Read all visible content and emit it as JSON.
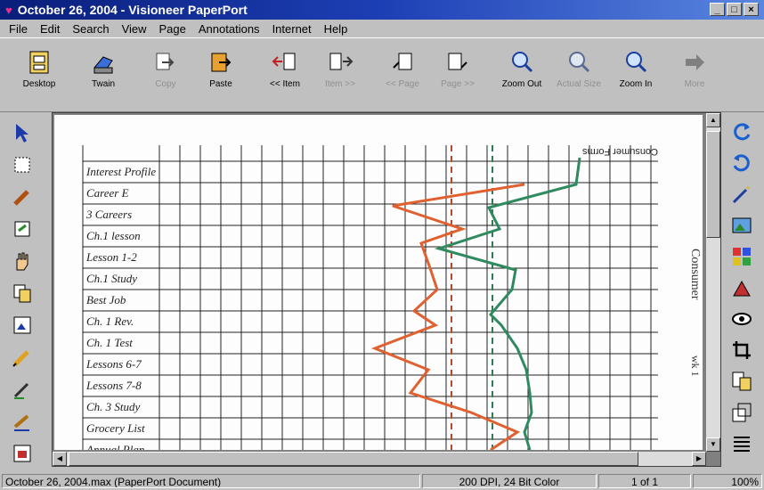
{
  "window": {
    "title": "October 26, 2004 - Visioneer PaperPort",
    "minimize": "_",
    "maximize": "□",
    "close": "×"
  },
  "menu": [
    "File",
    "Edit",
    "Search",
    "View",
    "Page",
    "Annotations",
    "Internet",
    "Help"
  ],
  "toolbar": {
    "desktop": "Desktop",
    "twain": "Twain",
    "copy": "Copy",
    "paste": "Paste",
    "item_back": "<< Item",
    "item_next": "Item >>",
    "page_back": "<< Page",
    "page_next": "Page >>",
    "zoom_out": "Zoom Out",
    "actual_size": "Actual Size",
    "zoom_in": "Zoom In",
    "more": "More"
  },
  "document": {
    "header_text": "Consumer Forms",
    "rows": [
      "Interest Profile",
      "Career E",
      "3 Careers",
      "Ch.1 lesson",
      "Lesson 1-2",
      "Ch.1 Study",
      "Best Job",
      "Ch. 1 Rev.",
      "Ch. 1 Test",
      "Lessons 6-7",
      "Lessons 7-8",
      "Ch. 3 Study",
      "Grocery List",
      "Annual Plan"
    ],
    "side_note": "Consumer",
    "side_note_2": "wk 1"
  },
  "status": {
    "filename": "October 26, 2004.max (PaperPort Document)",
    "resolution": "200 DPI, 24 Bit Color",
    "page": "1 of 1",
    "zoom": "100%"
  }
}
